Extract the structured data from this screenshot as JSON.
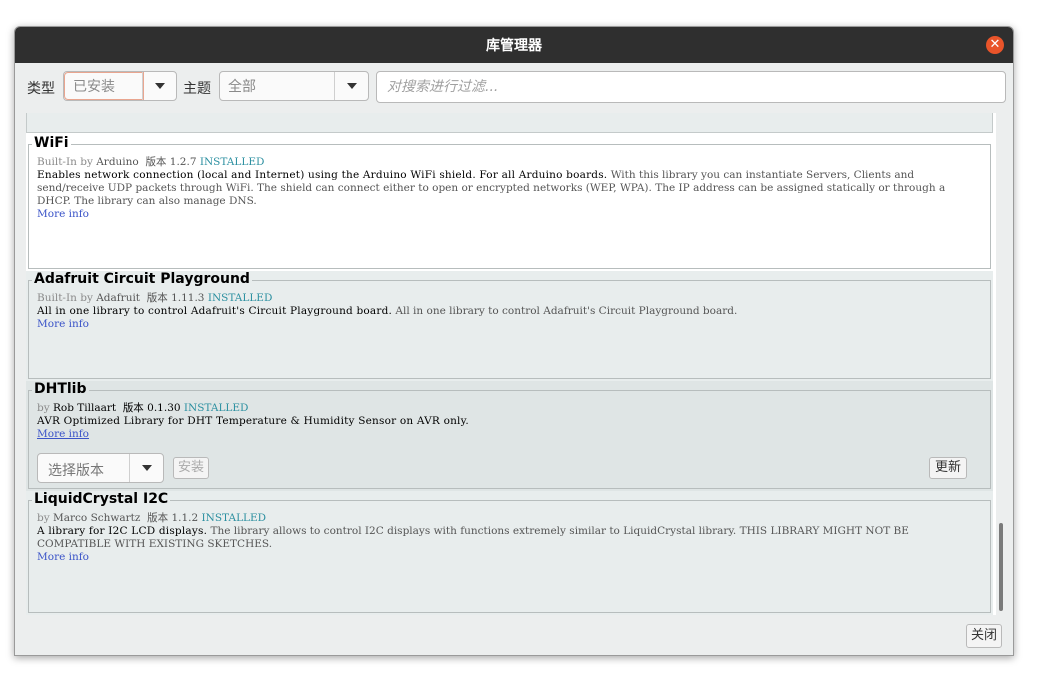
{
  "window": {
    "title": "库管理器"
  },
  "filter": {
    "type_label": "类型",
    "type_value": "已安装",
    "topic_label": "主题",
    "topic_value": "全部",
    "search_placeholder": "对搜索进行过滤..."
  },
  "libraries": [
    {
      "name": "WiFi",
      "by_prefix": "Built-In",
      "by": "by",
      "author": "Arduino",
      "version_label": "版本",
      "version": "1.2.7",
      "status": "INSTALLED",
      "sentence": "Enables network connection (local and Internet) using the Arduino WiFi shield. For all Arduino boards.",
      "paragraph": "With this library you can instantiate Servers, Clients and send/receive UDP packets through WiFi. The shield can connect either to open or encrypted networks (WEP, WPA). The IP address can be assigned statically or through a DHCP. The library can also manage DNS.",
      "more": "More info"
    },
    {
      "name": "Adafruit Circuit Playground",
      "by_prefix": "Built-In",
      "by": "by",
      "author": "Adafruit",
      "version_label": "版本",
      "version": "1.11.3",
      "status": "INSTALLED",
      "sentence": "All in one library to control Adafruit's Circuit Playground board.",
      "paragraph": "All in one library to control Adafruit's Circuit Playground board.",
      "more": "More info"
    },
    {
      "name": "DHTlib",
      "by": "by",
      "author": "Rob Tillaart",
      "version_label": "版本",
      "version": "0.1.30",
      "status": "INSTALLED",
      "sentence": "AVR Optimized Library for DHT Temperature & Humidity Sensor on AVR only.",
      "more": "More info",
      "select_version": "选择版本",
      "install": "安装",
      "update": "更新"
    },
    {
      "name": "LiquidCrystal I2C",
      "by": "by",
      "author": "Marco Schwartz",
      "version_label": "版本",
      "version": "1.1.2",
      "status": "INSTALLED",
      "sentence": "A library for I2C LCD displays.",
      "paragraph": "The library allows to control I2C displays with functions extremely similar to LiquidCrystal library. THIS LIBRARY MIGHT NOT BE COMPATIBLE WITH EXISTING SKETCHES.",
      "more": "More info"
    }
  ],
  "footer": {
    "close": "关闭"
  },
  "colors": {
    "titlebar": "#2f2f2f",
    "close_icon": "#e9542a",
    "installed": "#2b8fa0",
    "link": "#3b54c8"
  }
}
